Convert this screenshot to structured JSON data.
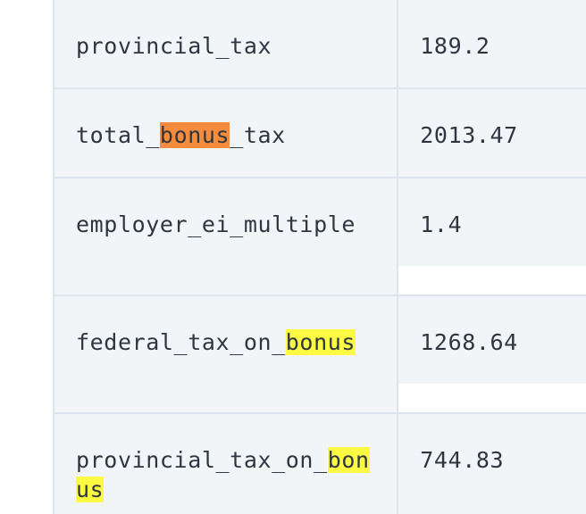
{
  "rows": [
    {
      "key": "provincial_tax",
      "value": "189.2"
    },
    {
      "key": "total_bonus_tax",
      "value": "2013.47"
    },
    {
      "key": "employer_ei_multiple",
      "value": "1.4"
    },
    {
      "key": "federal_tax_on_bonus",
      "value": "1268.64"
    },
    {
      "key": "provincial_tax_on_bonus",
      "value": "744.83"
    }
  ],
  "search": {
    "term": "bonus",
    "current_match_color": "#f58b3c",
    "match_color": "#fdfa43"
  }
}
